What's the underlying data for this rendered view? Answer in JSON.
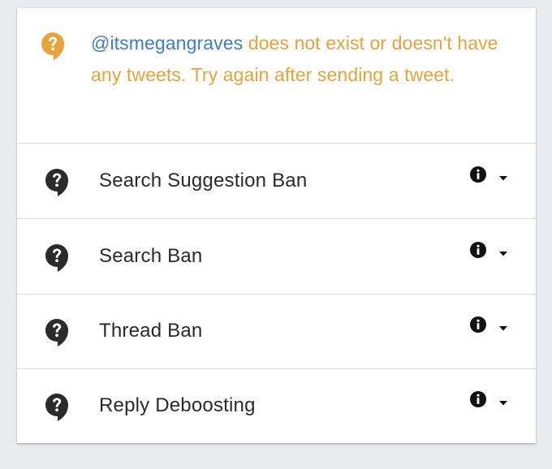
{
  "notice": {
    "handle": "@itsmegangraves",
    "message": " does not exist or doesn't have any tweets. Try again after sending a tweet.",
    "icon": "question-bubble-icon",
    "colors": {
      "warning": "#e8a33d",
      "link": "#3d7fbf"
    }
  },
  "checks": [
    {
      "label": "Search Suggestion Ban",
      "icon": "question-bubble-icon"
    },
    {
      "label": "Search Ban",
      "icon": "question-bubble-icon"
    },
    {
      "label": "Thread Ban",
      "icon": "question-bubble-icon"
    },
    {
      "label": "Reply Deboosting",
      "icon": "question-bubble-icon"
    }
  ],
  "colors": {
    "text": "#2a2a2a",
    "background": "#e9ebef",
    "card": "#ffffff"
  }
}
